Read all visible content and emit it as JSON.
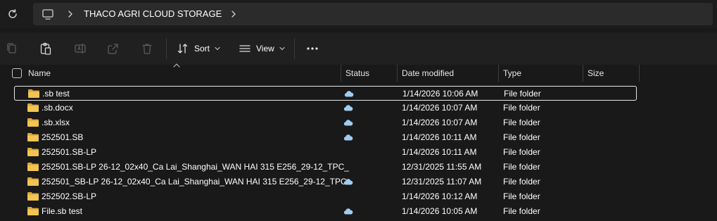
{
  "address_bar": {
    "breadcrumb": [
      "THACO AGRI CLOUD STORAGE"
    ]
  },
  "toolbar": {
    "sort_label": "Sort",
    "view_label": "View"
  },
  "columns": {
    "name": "Name",
    "status": "Status",
    "date_modified": "Date modified",
    "type": "Type",
    "size": "Size"
  },
  "files": [
    {
      "name": ".sb test",
      "status": "cloud",
      "date": "1/14/2026 10:06 AM",
      "type": "File folder",
      "selected": true
    },
    {
      "name": ".sb.docx",
      "status": "cloud",
      "date": "1/14/2026 10:07 AM",
      "type": "File folder"
    },
    {
      "name": ".sb.xlsx",
      "status": "cloud",
      "date": "1/14/2026 10:07 AM",
      "type": "File folder"
    },
    {
      "name": "252501.SB",
      "status": "cloud",
      "date": "1/14/2026 10:11 AM",
      "type": "File folder"
    },
    {
      "name": "252501.SB-LP",
      "status": "",
      "date": "1/14/2026 10:11 AM",
      "type": "File folder"
    },
    {
      "name": "252501.SB-LP 26-12_02x40_Ca Lai_Shanghai_WAN HAI 315 E256_29-12_TPC_",
      "status": "",
      "date": "12/31/2025 11:55 AM",
      "type": "File folder"
    },
    {
      "name": "252501_SB-LP 26-12_02x40_Ca Lai_Shanghai_WAN HAI 315 E256_29-12_TPC",
      "status": "cloud",
      "date": "12/31/2025 11:07 AM",
      "type": "File folder"
    },
    {
      "name": "252502.SB-LP",
      "status": "",
      "date": "1/14/2026 10:12 AM",
      "type": "File folder"
    },
    {
      "name": "File.sb test",
      "status": "cloud",
      "date": "1/14/2026 10:05 AM",
      "type": "File folder"
    }
  ],
  "colors": {
    "background": "#191919",
    "folder": "#f0c14b",
    "cloud": "#8fbfe8"
  }
}
